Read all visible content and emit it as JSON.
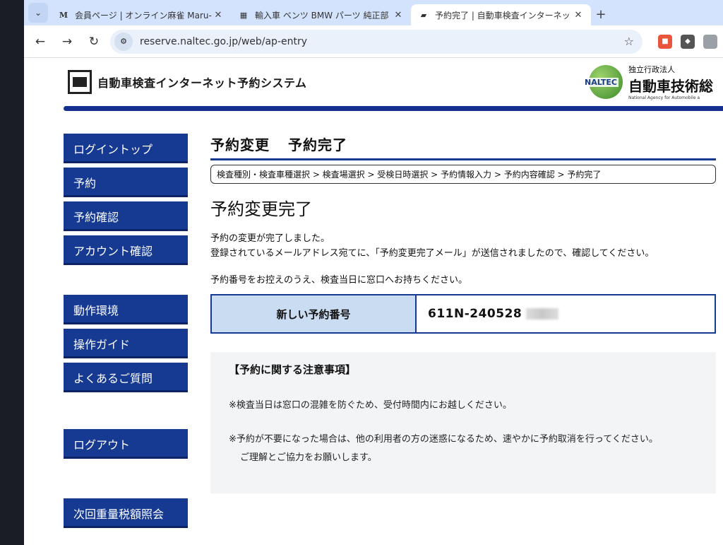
{
  "browser": {
    "tabs": [
      {
        "favicon": "M",
        "title": "会員ページ | オンライン麻雀 Maru-",
        "active": false
      },
      {
        "favicon": "▦",
        "title": "輸入車 ベンツ BMW パーツ 純正部",
        "active": false
      },
      {
        "favicon": "▰",
        "title": "予約完了 | 自動車検査インターネット",
        "active": true
      }
    ],
    "url": "reserve.naltec.go.jp/web/ap-entry"
  },
  "header": {
    "site_title": "自動車検査インターネット予約システム",
    "org_logo_word": "NALTEC",
    "org_prefix": "独立行政法人",
    "org_name": "自動車技術総",
    "org_name_en": "National Agency for Automobile a"
  },
  "sidebar": {
    "group1": [
      "ログイントップ",
      "予約",
      "予約確認",
      "アカウント確認"
    ],
    "group2": [
      "動作環境",
      "操作ガイド",
      "よくあるご質問"
    ],
    "logout": "ログアウト",
    "bottom": "次回重量税額照会"
  },
  "main": {
    "heading_part1": "予約変更",
    "heading_part2": "予約完了",
    "breadcrumb": "検査種別・検査車種選択 > 検査場選択 > 受検日時選択 > 予約情報入力 > 予約内容確認 > 予約完了",
    "done_title": "予約変更完了",
    "message_line1": "予約の変更が完了しました。",
    "message_line2": "登録されているメールアドレス宛てに、「予約変更完了メール」が送信されましたので、確認してください。",
    "message_line3": "予約番号をお控えのうえ、検査当日に窓口へお持ちください。",
    "reservation_label": "新しい予約番号",
    "reservation_number": "611N-240528",
    "notice_title": "【予約に関する注意事項】",
    "notice_item1": "※検査当日は窓口の混雑を防ぐため、受付時間内にお越しください。",
    "notice_item2_line1": "※予約が不要になった場合は、他の利用者の方の迷惑になるため、速やかに予約取消を行ってください。",
    "notice_item2_line2": "ご理解とご協力をお願いします。"
  },
  "colors": {
    "nav_blue": "#163a92",
    "label_bg": "#c9dcf2",
    "tabstrip_bg": "#d3e3fd"
  }
}
